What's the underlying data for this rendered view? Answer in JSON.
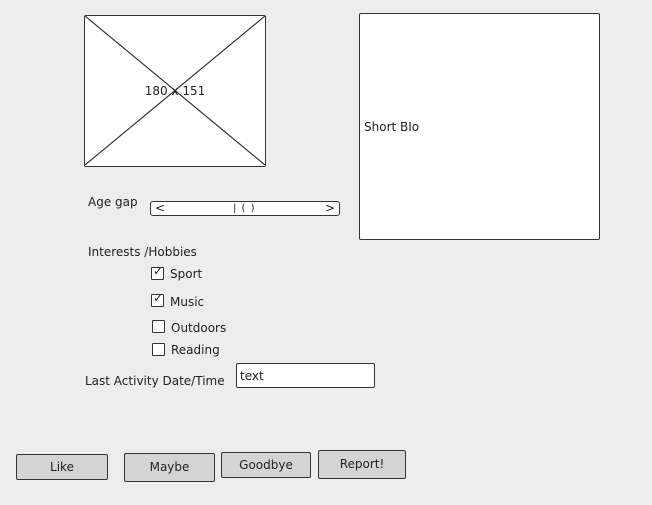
{
  "image": {
    "placeholder_text": "180 x 151"
  },
  "bio": {
    "label": "Short BIo"
  },
  "age_gap": {
    "label": "Age gap",
    "left_arrow": "<",
    "right_arrow": ">",
    "thumb": "| ( )"
  },
  "interests": {
    "heading": "Interests /Hobbies",
    "items": [
      {
        "label": "Sport",
        "checked": true
      },
      {
        "label": "Music",
        "checked": true
      },
      {
        "label": "Outdoors",
        "checked": false
      },
      {
        "label": "Reading",
        "checked": false
      }
    ],
    "check_glyph": "✓"
  },
  "last_activity": {
    "label": "Last Activity Date/Time",
    "value": "text"
  },
  "buttons": {
    "like": "Like",
    "maybe": "Maybe",
    "goodbye": "Goodbye",
    "report": "Report!"
  }
}
